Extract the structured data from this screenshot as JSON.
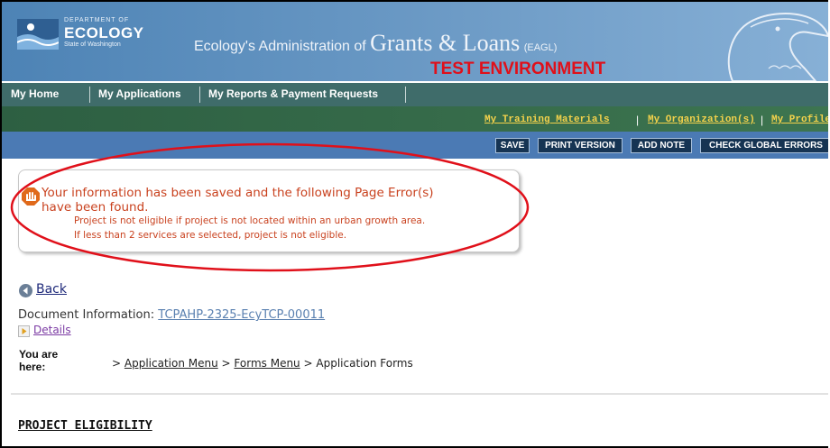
{
  "header": {
    "logo": {
      "dept": "DEPARTMENT OF",
      "name": "ECOLOGY",
      "state": "State of Washington"
    },
    "title_prefix": "Ecology's Administration of",
    "title_main": "Grants & Loans",
    "title_abbr": "(EAGL)",
    "environment": "TEST ENVIRONMENT",
    "environment_color": "#e0101a"
  },
  "nav": {
    "items": [
      {
        "label": "My Home"
      },
      {
        "label": "My Applications"
      },
      {
        "label": "My Reports & Payment Requests"
      }
    ]
  },
  "subnav": {
    "links": [
      {
        "label": "My Training Materials"
      },
      {
        "label": "My Organization(s)"
      },
      {
        "label": "My Profile"
      }
    ],
    "separator": "|"
  },
  "actions": {
    "save": "SAVE",
    "print": "PRINT VERSION",
    "add_note": "ADD NOTE",
    "check_errors": "CHECK GLOBAL ERRORS"
  },
  "error_panel": {
    "message_line1": "Your information has been saved and the following Page Error(s)",
    "message_line2": "have been found.",
    "details": [
      "Project is not eligible if project is not located within an urban growth area.",
      "If less than 2 services are selected, project is not eligible."
    ],
    "color": "#c9421f",
    "highlight_color": "#e0101a"
  },
  "page": {
    "back_label": "Back",
    "doc_info_label": "Document Information:",
    "doc_id": "TCPAHP-2325-EcyTCP-00011",
    "details_label": "Details",
    "you_are_here": "You are here:",
    "breadcrumb_sep": ">",
    "breadcrumb": [
      "Application Menu",
      "Forms Menu",
      "Application Forms"
    ],
    "section_title": "PROJECT ELIGIBILITY"
  }
}
